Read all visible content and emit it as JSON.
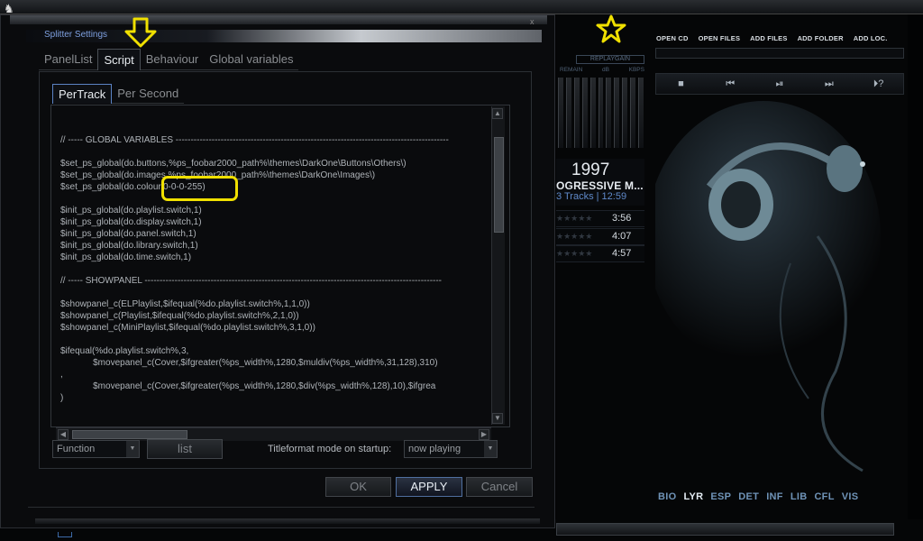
{
  "player": {
    "logo_glyph": "♞",
    "top_buttons": [
      "OPEN CD",
      "OPEN FILES",
      "ADD FILES",
      "ADD FOLDER",
      "ADD LOC."
    ],
    "eq_header": "REPLAYGAIN",
    "eq_labels": [
      "REMAIN",
      "dB",
      "KBPS"
    ],
    "transport": [
      "■",
      "⏮",
      "⏯",
      "⏭",
      "⏵?"
    ],
    "album_year": "1997",
    "album_genre": "OGRESSIVE M...",
    "album_tracks": "3 Tracks | 12:59",
    "tracks": [
      {
        "stars": "★★★★★",
        "duration": "3:56"
      },
      {
        "stars": "★★★★★",
        "duration": "4:07"
      },
      {
        "stars": "★★★★★",
        "duration": "4:57"
      }
    ],
    "bottom_tabs": [
      "BIO",
      "LYR",
      "ESP",
      "DET",
      "INF",
      "LIB",
      "CFL",
      "VIS"
    ],
    "active_bottom_tab": "LYR"
  },
  "dialog": {
    "title": "Splitter Settings",
    "close_glyph": "x",
    "tabs": [
      "PanelList",
      "Script",
      "Behaviour",
      "Global variables"
    ],
    "active_tab": "Script",
    "subtabs": [
      "PerTrack",
      "Per Second"
    ],
    "active_subtab": "PerTrack",
    "script_lines": [
      "// ----- GLOBAL VARIABLES -------------------------------------------------------------------------------------------",
      "",
      "$set_ps_global(do.buttons,%ps_foobar2000_path%\\themes\\DarkOne\\Buttons\\Others\\)",
      "$set_ps_global(do.images,%ps_foobar2000_path%\\themes\\DarkOne\\Images\\)",
      "$set_ps_global(do.colour,0-0-0-255)",
      "",
      "$init_ps_global(do.playlist.switch,1)",
      "$init_ps_global(do.display.switch,1)",
      "$init_ps_global(do.panel.switch,1)",
      "$init_ps_global(do.library.switch,1)",
      "$init_ps_global(do.time.switch,1)",
      "",
      "// ----- SHOWPANEL ---------------------------------------------------------------------------------------------------",
      "",
      "$showpanel_c(ELPlaylist,$ifequal(%do.playlist.switch%,1,1,0))",
      "$showpanel_c(Playlist,$ifequal(%do.playlist.switch%,2,1,0))",
      "$showpanel_c(MiniPlaylist,$ifequal(%do.playlist.switch%,3,1,0))",
      "",
      "$ifequal(%do.playlist.switch%,3,",
      "             $movepanel_c(Cover,$ifgreater(%ps_width%,1280,$muldiv(%ps_width%,31,128),310)",
      ",",
      "             $movepanel_c(Cover,$ifgreater(%ps_width%,1280,$div(%ps_width%,128),10),$ifgrea",
      ")"
    ],
    "function_select": "Function",
    "list_button": "list",
    "titleformat_label": "Titleformat mode on startup:",
    "titleformat_select": "now playing",
    "ok_button": "OK",
    "apply_button": "APPLY",
    "cancel_button": "Cancel"
  },
  "colors": {
    "annotation": "#f0e000",
    "accent_blue": "#5b83c4",
    "background": "#0a0b0d"
  }
}
